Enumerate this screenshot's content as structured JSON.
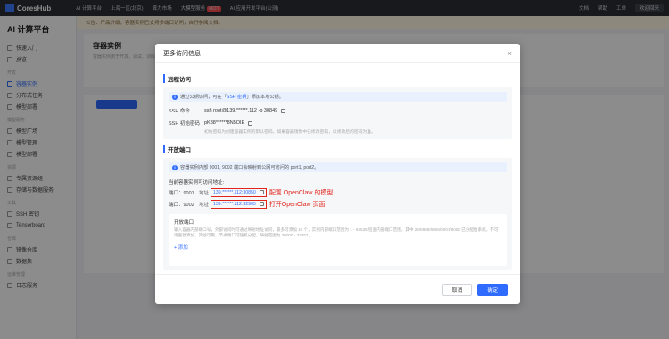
{
  "topbar": {
    "brand": "CoresHub",
    "nav": [
      "AI 计算平台",
      "上海一区(北京)",
      "算力市场",
      "大模型服务",
      "AI 应用开发平台(公测)"
    ],
    "hot_badge": "HOT",
    "right": [
      "文档",
      "帮助",
      "工单"
    ],
    "user": "欢迎回来"
  },
  "sidebar": {
    "title": "AI 计算平台",
    "items": [
      {
        "label": "快速入门",
        "group": ""
      },
      {
        "label": "总览",
        "group": ""
      },
      {
        "label": "容器实例",
        "group": "开发",
        "active": true
      },
      {
        "label": "分布式任务",
        "group": ""
      },
      {
        "label": "模型部署",
        "group": ""
      },
      {
        "label": "模型广场",
        "group": "模型服务"
      },
      {
        "label": "模型管理",
        "group": ""
      },
      {
        "label": "模型部署",
        "group": ""
      },
      {
        "label": "专属资源组",
        "group": "资源"
      },
      {
        "label": "存储与数据服务",
        "group": ""
      },
      {
        "label": "SSH 密钥",
        "group": "工具"
      },
      {
        "label": "Tensorboard",
        "group": ""
      },
      {
        "label": "镜像仓库",
        "group": "仓库"
      },
      {
        "label": "数据集",
        "group": ""
      },
      {
        "label": "日志服务",
        "group": "运维管理"
      }
    ]
  },
  "notice": "公告：产品升级，容器实例已支持多端口访问，自行参阅文档。",
  "page": {
    "title": "容器实例",
    "subtitle": "容器实例用于开发、调试、训练等场景"
  },
  "modal": {
    "title": "更多访问信息",
    "close": "×",
    "remote": {
      "title": "远程访问",
      "info_prefix": "通过公钥访问，可在「",
      "info_link": "SSH 密钥",
      "info_suffix": "」添加本地公钥。",
      "ssh_cmd_label": "SSH 命令",
      "ssh_cmd_value": "ssh root@139.******.112 -p 30849",
      "pwd_label": "SSH 初始密码",
      "pwd_value": "pK38******8N5OIE",
      "pwd_hint": "初始密码为创建容器实例的默认密码，如果容器镜像中已修改密码，以修改后的密码为准。"
    },
    "ports": {
      "title": "开放端口",
      "info": "容器实例内部 9001, 9002 端口会映射到公网可访问的 port1, port2。",
      "current_title": "当前容器实例可访问地址:",
      "rows": [
        {
          "port_label": "端口：9001",
          "addr_label": "地址",
          "addr": "139.******.112:30850",
          "annotation": "配置 OpenClaw 的模型"
        },
        {
          "port_label": "端口：9002",
          "addr_label": "地址",
          "addr": "139.******.112:32905",
          "annotation": "打开OpenClaw 页面"
        }
      ],
      "open_title": "开放端口",
      "open_desc": "输入容器内部端口号，外部访问时可通过映射地址访问，最多可添加 10 个，实例内部端口范围为 1 - 65535 检查内部端口范围，其中 22/8888/6006/5001/9002 已分配给系统，不可再重复添加，其他可用，节点端口可随机分配，映射范围为 30000 - 32767。",
      "add": "+ 添加"
    },
    "cancel": "取消",
    "ok": "确定"
  }
}
